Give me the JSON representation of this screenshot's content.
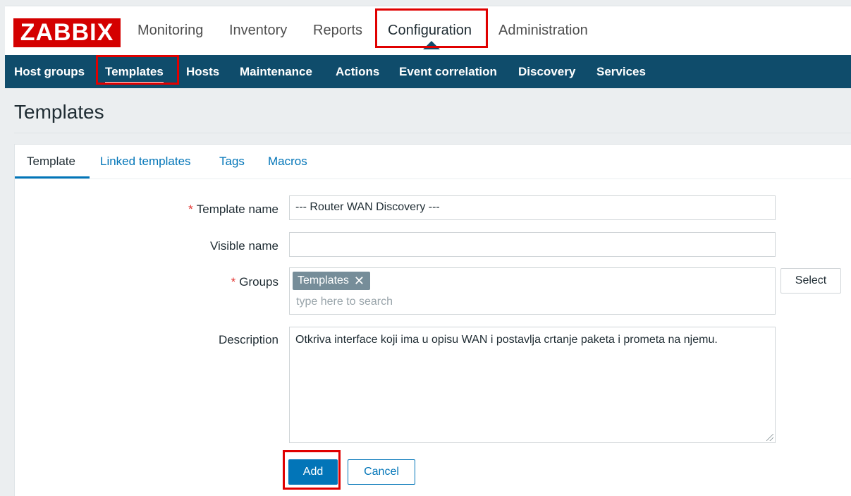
{
  "app": {
    "logo_text": "ZABBIX",
    "brand_color": "#d40000",
    "accent_color": "#0275b8",
    "nav_bg_color": "#0f4c6b"
  },
  "main_menu": {
    "items": [
      {
        "label": "Monitoring"
      },
      {
        "label": "Inventory"
      },
      {
        "label": "Reports"
      },
      {
        "label": "Configuration",
        "active": true
      },
      {
        "label": "Administration"
      }
    ]
  },
  "sub_menu": {
    "items": [
      {
        "label": "Host groups"
      },
      {
        "label": "Templates",
        "active": true
      },
      {
        "label": "Hosts"
      },
      {
        "label": "Maintenance"
      },
      {
        "label": "Actions"
      },
      {
        "label": "Event correlation"
      },
      {
        "label": "Discovery"
      },
      {
        "label": "Services"
      }
    ]
  },
  "page": {
    "title": "Templates"
  },
  "tabs": [
    {
      "label": "Template",
      "active": true
    },
    {
      "label": "Linked templates"
    },
    {
      "label": "Tags"
    },
    {
      "label": "Macros"
    }
  ],
  "form": {
    "required_marker": "*",
    "template_name": {
      "label": "Template name",
      "value": "--- Router WAN Discovery ---"
    },
    "visible_name": {
      "label": "Visible name",
      "value": ""
    },
    "groups": {
      "label": "Groups",
      "chips": [
        {
          "label": "Templates",
          "remove_icon": "close-icon"
        }
      ],
      "placeholder": "type here to search",
      "select_label": "Select"
    },
    "description": {
      "label": "Description",
      "value": "Otkriva interface koji ima u opisu WAN i postavlja crtanje paketa i prometa na njemu."
    },
    "add_label": "Add",
    "cancel_label": "Cancel"
  }
}
